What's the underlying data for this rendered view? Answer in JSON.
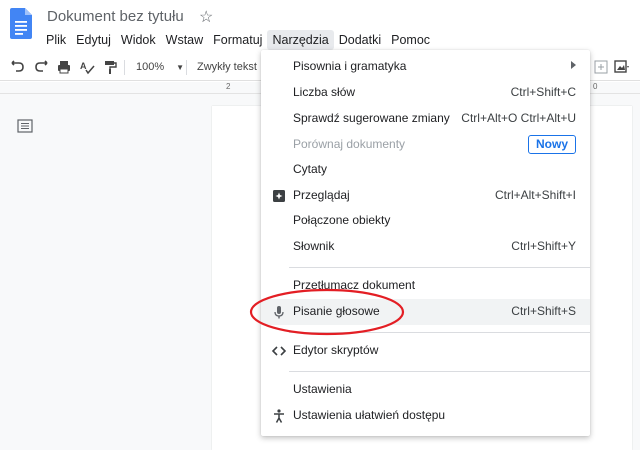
{
  "app": {
    "title": "Dokument bez tytułu"
  },
  "menubar": {
    "items": [
      "Plik",
      "Edytuj",
      "Widok",
      "Wstaw",
      "Formatuj",
      "Narzędzia",
      "Dodatki",
      "Pomoc"
    ],
    "active": "Narzędzia"
  },
  "toolbar": {
    "zoom": "100%",
    "style": "Zwykły tekst"
  },
  "ruler": {
    "left": "2",
    "right": "0"
  },
  "tools_menu": {
    "items": [
      {
        "label": "Pisownia i gramatyka",
        "submenu": true
      },
      {
        "label": "Liczba słów",
        "shortcut": "Ctrl+Shift+C"
      },
      {
        "label": "Sprawdź sugerowane zmiany",
        "shortcut": "Ctrl+Alt+O Ctrl+Alt+U"
      },
      {
        "label": "Porównaj dokumenty",
        "disabled": true,
        "badge": "Nowy"
      },
      {
        "label": "Cytaty"
      },
      {
        "label": "Przeglądaj",
        "shortcut": "Ctrl+Alt+Shift+I",
        "icon": "explore-icon"
      },
      {
        "label": "Połączone obiekty"
      },
      {
        "label": "Słownik",
        "shortcut": "Ctrl+Shift+Y"
      },
      {
        "label": "Przetłumacz dokument"
      },
      {
        "label": "Pisanie głosowe",
        "shortcut": "Ctrl+Shift+S",
        "icon": "microphone-icon",
        "highlighted": true
      },
      {
        "label": "Edytor skryptów",
        "icon": "code-icon"
      },
      {
        "label": "Ustawienia"
      },
      {
        "label": "Ustawienia ułatwień dostępu",
        "icon": "accessibility-icon"
      }
    ]
  },
  "colors": {
    "accent": "#1a73e8",
    "annotation": "#e31e24",
    "docs_blue": "#4285f4"
  }
}
